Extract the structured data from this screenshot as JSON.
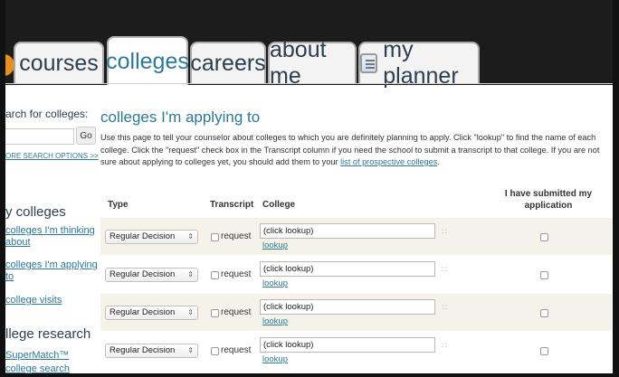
{
  "tabs": [
    {
      "label": "courses",
      "active": false
    },
    {
      "label": "colleges",
      "active": true
    },
    {
      "label": "careers",
      "active": false
    },
    {
      "label": "about me",
      "active": false
    },
    {
      "label": "my planner",
      "active": false,
      "icon": "planner-icon"
    }
  ],
  "sidebar": {
    "search_label": "arch for colleges:",
    "go_label": "Go",
    "more_search": "ORE SEARCH OPTIONS >>",
    "my_colleges_heading": "y colleges",
    "links": [
      {
        "label": "colleges I'm thinking about"
      },
      {
        "label": "colleges I'm applying to"
      },
      {
        "label": "college visits"
      }
    ],
    "research_heading": "llege research",
    "research_links": [
      {
        "label": "SuperMatch™"
      },
      {
        "label": "college search"
      }
    ]
  },
  "main": {
    "title": "colleges I'm applying to",
    "intro_text": "Use this page to tell your counselor about colleges to which you are definitely planning to apply. Click \"lookup\" to find the name of each college. Click the \"request\" check box in the Transcript column if you need the school to submit a transcript to that college. If you are not sure about applying to colleges yet, you should add them to your ",
    "intro_link": "list of prospective colleges",
    "intro_end": ".",
    "columns": {
      "type": "Type",
      "transcript": "Transcript",
      "college": "College",
      "submitted": "I have submitted my application"
    },
    "rows": [
      {
        "type": "Regular Decision",
        "request_label": "request",
        "request_checked": false,
        "college": "(click lookup)",
        "lookup": "lookup",
        "submitted": false
      },
      {
        "type": "Regular Decision",
        "request_label": "request",
        "request_checked": false,
        "college": "(click lookup)",
        "lookup": "lookup",
        "submitted": false
      },
      {
        "type": "Regular Decision",
        "request_label": "request",
        "request_checked": false,
        "college": "(click lookup)",
        "lookup": "lookup",
        "submitted": false
      },
      {
        "type": "Regular Decision",
        "request_label": "request",
        "request_checked": false,
        "college": "(click lookup)",
        "lookup": "lookup",
        "submitted": false
      }
    ]
  },
  "colors": {
    "accent": "#2b7a99",
    "row_alt": "#f5f3e9",
    "top_bar": "#1c1c1c",
    "orange_icon": "#e8901c"
  }
}
